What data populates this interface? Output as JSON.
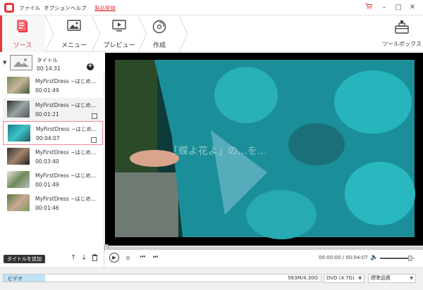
{
  "menu": {
    "file": "ファイル",
    "options": "オプション",
    "help": "ヘルプ",
    "buy": "製品登録"
  },
  "steps": [
    {
      "label": "ソース"
    },
    {
      "label": "メニュー"
    },
    {
      "label": "プレビュー"
    },
    {
      "label": "作成"
    }
  ],
  "toolbox": {
    "label": "ツールボックス"
  },
  "title_group": {
    "label": "タイトル",
    "duration": "00:14:31"
  },
  "clips": [
    {
      "name": "MyFirstDress ~はじめ...",
      "duration": "00:01:49"
    },
    {
      "name": "MyFirstDress ~はじめ...",
      "duration": "00:01:21"
    },
    {
      "name": "MyFirstDress ~はじめ...",
      "duration": "00:04:07"
    },
    {
      "name": "MyFirstDress ~はじめ...",
      "duration": "00:03:40"
    },
    {
      "name": "MyFirstDress ~はじめ...",
      "duration": "00:01:49"
    },
    {
      "name": "MyFirstDress ~はじめ...",
      "duration": "00:01:46"
    }
  ],
  "video": {
    "subtitle": "「蝶よ花よ」の…を…"
  },
  "controls": {
    "add_title": "タイトルを追加",
    "time": "00:00:00 / 00:04:07",
    "volume": 0.85,
    "progress": 0.0
  },
  "disc": {
    "label": "ビデオ",
    "size": "563M/4.30G",
    "usage": 0.13,
    "type": "DVD (4.7G)",
    "quality": "標準品質"
  },
  "colors": {
    "accent": "#e8383d",
    "disc_fill": "#bfe2f7"
  }
}
